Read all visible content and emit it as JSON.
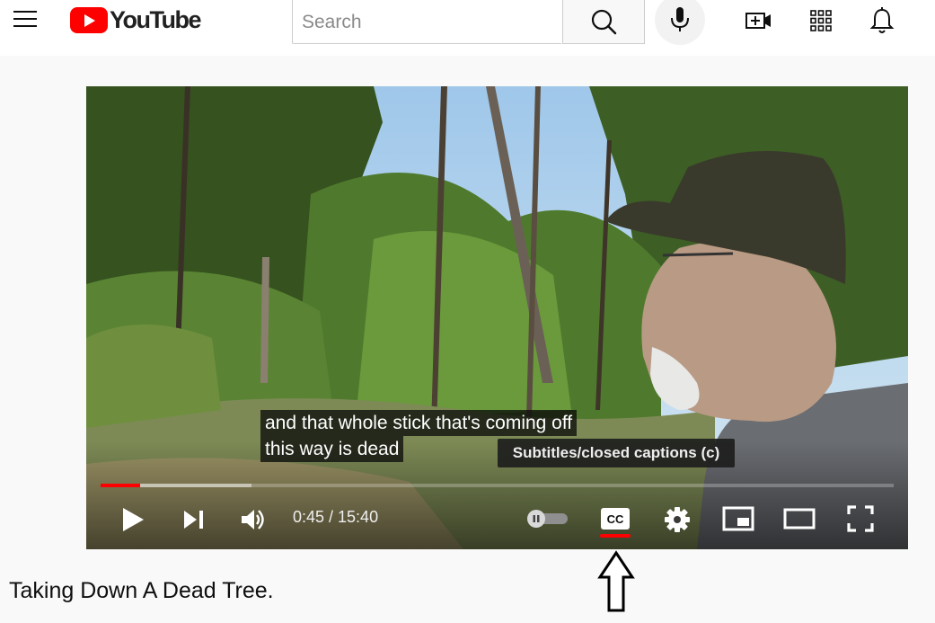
{
  "masthead": {
    "logo_text": "YouTube",
    "search": {
      "placeholder": "Search",
      "value": ""
    },
    "icons": [
      "menu-icon",
      "search-icon",
      "microphone-icon",
      "create-video-icon",
      "apps-grid-icon",
      "notifications-bell-icon"
    ]
  },
  "player": {
    "caption_lines": [
      "and that whole stick that's coming off",
      "this way is dead"
    ],
    "tooltip": "Subtitles/closed captions (c)",
    "time_display": "0:45 / 15:40",
    "progress": {
      "played_fraction": 0.05,
      "loaded_fraction": 0.19
    },
    "autoplay_enabled": false,
    "captions_enabled": true,
    "controls": [
      "play-icon",
      "next-icon",
      "volume-icon",
      "autoplay-toggle",
      "cc-icon",
      "settings-gear-icon",
      "miniplayer-icon",
      "theater-mode-icon",
      "fullscreen-icon"
    ]
  },
  "video": {
    "title": "Taking Down A Dead Tree."
  },
  "colors": {
    "brand_red": "#ff0000",
    "page_bg": "#f9f9f9",
    "text": "#0f0f0f"
  }
}
